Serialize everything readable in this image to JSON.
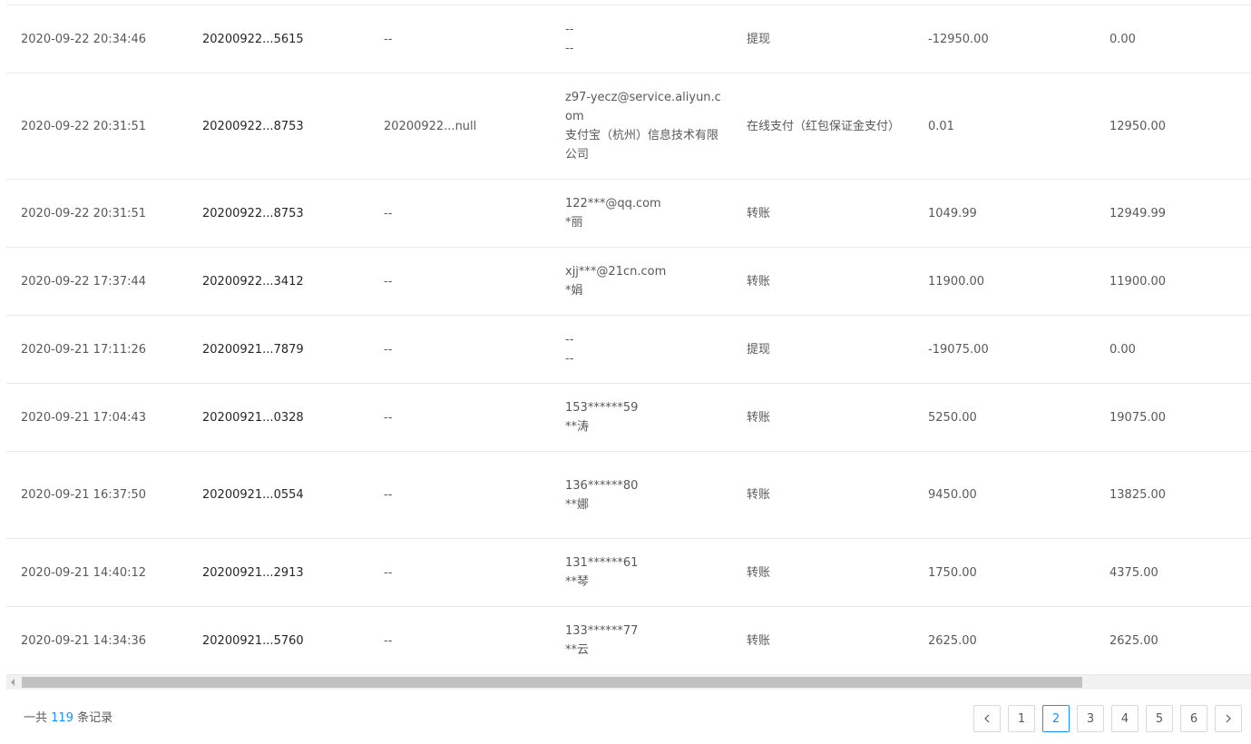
{
  "rows": [
    {
      "time": "2020-09-22 20:34:46",
      "order": "20200922...5615",
      "ref": "--",
      "party": [
        "--",
        "--"
      ],
      "type": "提现",
      "amount": "-12950.00",
      "balance": "0.00"
    },
    {
      "time": "2020-09-22 20:31:51",
      "order": "20200922...8753",
      "ref": "20200922...null",
      "party": [
        "z97-yecz@service.aliyun.com",
        "支付宝（杭州）信息技术有限公司"
      ],
      "type": "在线支付（红包保证金支付）",
      "amount": "0.01",
      "balance": "12950.00"
    },
    {
      "time": "2020-09-22 20:31:51",
      "order": "20200922...8753",
      "ref": "--",
      "party": [
        "122***@qq.com",
        "*丽"
      ],
      "type": "转账",
      "amount": "1049.99",
      "balance": "12949.99"
    },
    {
      "time": "2020-09-22 17:37:44",
      "order": "20200922...3412",
      "ref": "--",
      "party": [
        "xjj***@21cn.com",
        "*娟"
      ],
      "type": "转账",
      "amount": "11900.00",
      "balance": "11900.00"
    },
    {
      "time": "2020-09-21 17:11:26",
      "order": "20200921...7879",
      "ref": "--",
      "party": [
        "--",
        "--"
      ],
      "type": "提现",
      "amount": "-19075.00",
      "balance": "0.00"
    },
    {
      "time": "2020-09-21 17:04:43",
      "order": "20200921...0328",
      "ref": "--",
      "party": [
        "153******59",
        "**涛"
      ],
      "type": "转账",
      "amount": "5250.00",
      "balance": "19075.00"
    },
    {
      "time": "2020-09-21 16:37:50",
      "order": "20200921...0554",
      "ref": "--",
      "party": [
        "136******80",
        "**娜"
      ],
      "type": "转账",
      "amount": "9450.00",
      "balance": "13825.00"
    },
    {
      "time": "2020-09-21 14:40:12",
      "order": "20200921...2913",
      "ref": "--",
      "party": [
        "131******61",
        "**琴"
      ],
      "type": "转账",
      "amount": "1750.00",
      "balance": "4375.00"
    },
    {
      "time": "2020-09-21 14:34:36",
      "order": "20200921...5760",
      "ref": "--",
      "party": [
        "133******77",
        "**云"
      ],
      "type": "转账",
      "amount": "2625.00",
      "balance": "2625.00"
    }
  ],
  "pagination": {
    "total_prefix": "一共",
    "total_count": "119",
    "total_suffix": "条记录",
    "pages": [
      "1",
      "2",
      "3",
      "4",
      "5",
      "6"
    ],
    "current": "2"
  },
  "icons": {
    "prev": "chevron-left-icon",
    "next": "chevron-right-icon"
  },
  "colors": {
    "accent": "#1890ff",
    "border": "#d9d9d9"
  }
}
